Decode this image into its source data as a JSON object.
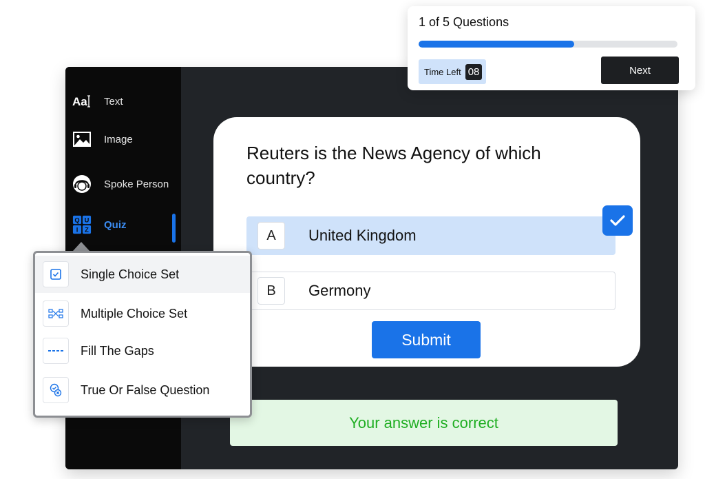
{
  "sidebar": {
    "items": [
      {
        "label": "Text",
        "icon": "text-icon"
      },
      {
        "label": "Image",
        "icon": "image-icon"
      },
      {
        "label": "Spoke Person",
        "icon": "person-icon"
      },
      {
        "label": "Quiz",
        "icon": "quiz-icon",
        "active": true
      }
    ]
  },
  "progress": {
    "title": "1 of 5 Questions",
    "current": 1,
    "total": 5,
    "fill_fraction": 0.6,
    "time_label": "Time Left",
    "time_value": "08",
    "next_label": "Next"
  },
  "quiz": {
    "question": "Reuters is the News Agency of which country?",
    "options": [
      {
        "letter": "A",
        "text": "United Kingdom",
        "selected": true
      },
      {
        "letter": "B",
        "text": "Germony",
        "selected": false
      }
    ],
    "submit_label": "Submit",
    "feedback": "Your answer is correct"
  },
  "quiz_menu": {
    "items": [
      {
        "label": "Single Choice Set",
        "icon": "single-choice-icon"
      },
      {
        "label": "Multiple Choice Set",
        "icon": "multiple-choice-icon"
      },
      {
        "label": "Fill The Gaps",
        "icon": "fill-gaps-icon"
      },
      {
        "label": "True Or False Question",
        "icon": "true-false-icon"
      }
    ]
  },
  "colors": {
    "accent": "#1a73e8",
    "selected_option": "#cfe2fa",
    "success_text": "#1fae22",
    "success_bg": "#e3f7e4",
    "sidebar_bg": "#0a0a0a",
    "workspace_bg": "#212428"
  }
}
